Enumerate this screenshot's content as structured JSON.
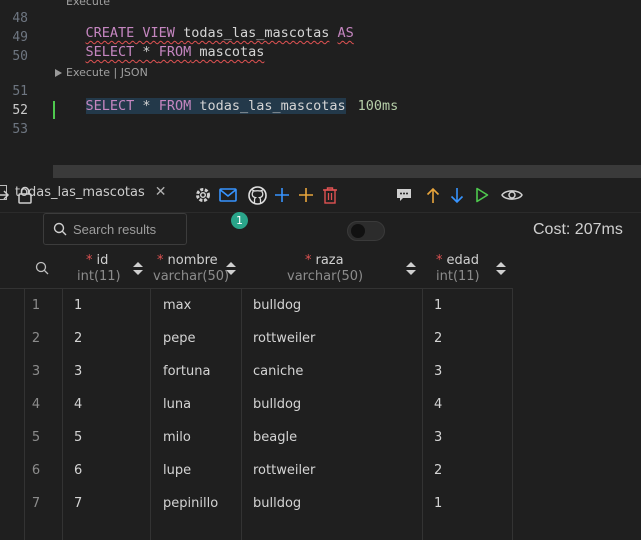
{
  "editor": {
    "lines": [
      {
        "num": "48",
        "tokens": [
          {
            "t": "CREATE",
            "c": "kw"
          },
          {
            "t": " VIEW ",
            "c": "kw"
          },
          {
            "t": "todas_las_mascotas",
            "c": "txt"
          },
          {
            "t": " ",
            "c": "txt"
          },
          {
            "t": "AS",
            "c": "kw"
          }
        ]
      },
      {
        "num": "49",
        "tokens": [
          {
            "t": "SELECT",
            "c": "kw"
          },
          {
            "t": " * ",
            "c": "txt"
          },
          {
            "t": "FROM",
            "c": "kw"
          },
          {
            "t": " mascotas",
            "c": "txt"
          }
        ]
      },
      {
        "num": "50"
      },
      {
        "num": "51",
        "tokens": [
          {
            "t": "SELECT",
            "c": "kw"
          },
          {
            "t": " * ",
            "c": "txt"
          },
          {
            "t": "FROM",
            "c": "kw"
          },
          {
            "t": " todas_las_mascotas",
            "c": "txt"
          }
        ]
      },
      {
        "num": "52"
      },
      {
        "num": "53"
      }
    ],
    "lens_top": "Execute",
    "lens_mid": "Execute | JSON",
    "timing": "100ms"
  },
  "results": {
    "tab_title": "todas_las_mascotas",
    "tab_close": "✕",
    "search_placeholder": "Search results",
    "badge_count": "1",
    "cost": "Cost: 207ms",
    "columns": [
      {
        "name": "id",
        "type": "int(11)"
      },
      {
        "name": "nombre",
        "type": "varchar(50)"
      },
      {
        "name": "raza",
        "type": "varchar(50)"
      },
      {
        "name": "edad",
        "type": "int(11)"
      }
    ],
    "rows": [
      {
        "n": "1",
        "id": "1",
        "nombre": "max",
        "raza": "bulldog",
        "edad": "1"
      },
      {
        "n": "2",
        "id": "2",
        "nombre": "pepe",
        "raza": "rottweiler",
        "edad": "2"
      },
      {
        "n": "3",
        "id": "3",
        "nombre": "fortuna",
        "raza": "caniche",
        "edad": "3"
      },
      {
        "n": "4",
        "id": "4",
        "nombre": "luna",
        "raza": "bulldog",
        "edad": "4"
      },
      {
        "n": "5",
        "id": "5",
        "nombre": "milo",
        "raza": "beagle",
        "edad": "3"
      },
      {
        "n": "6",
        "id": "6",
        "nombre": "lupe",
        "raza": "rottweiler",
        "edad": "2"
      },
      {
        "n": "7",
        "id": "7",
        "nombre": "pepinillo",
        "raza": "bulldog",
        "edad": "1"
      }
    ]
  },
  "colors": {
    "keyword": "#c586c0",
    "accent_blue": "#3794ff",
    "accent_orange": "#e8a53c",
    "accent_red": "#e05252",
    "accent_green": "#4ec94e"
  },
  "icons": {
    "share": "share-icon",
    "lock": "lock-icon",
    "search": "search-icon",
    "settings": "gear-icon",
    "mail": "mail-icon",
    "github": "github-icon",
    "add_row": "plus-icon",
    "add_col": "plus-orange-icon",
    "delete": "trash-icon",
    "comment": "comment-icon",
    "up": "arrow-up-icon",
    "down": "arrow-down-icon",
    "run": "play-icon",
    "preview": "eye-icon"
  }
}
